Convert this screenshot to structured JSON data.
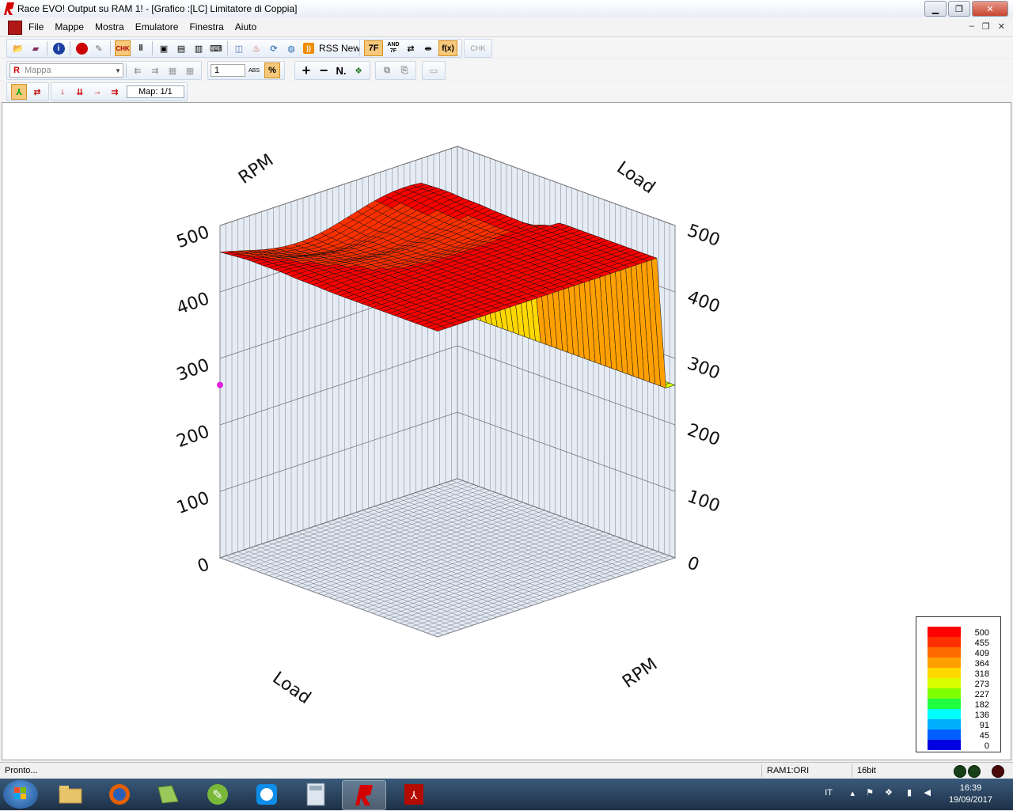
{
  "window": {
    "title": "Race EVO! Output su RAM 1! - [Grafico :[LC] Limitatore di Coppia]"
  },
  "menu": {
    "items": [
      "File",
      "Mappe",
      "Mostra",
      "Emulatore",
      "Finestra",
      "Aiuto"
    ]
  },
  "toolbar1": {
    "rss_label": "RSS News",
    "btn_7f": "7F",
    "btn_and": "AND 7F",
    "btn_fx": "f(x)",
    "btn_chk": "CHK"
  },
  "toolbar2": {
    "map_combo_prefix": "R",
    "map_combo_value": "Mappa",
    "step_value": "1",
    "abs_label": "ABS",
    "n_label": "N."
  },
  "toolbar3": {
    "map_counter": "Map: 1/1"
  },
  "chart_data": {
    "type": "surface3d",
    "axes": {
      "x_label": "Load",
      "y_label": "RPM",
      "z_ticks": [
        "0",
        "100",
        "200",
        "300",
        "400",
        "500"
      ],
      "z_range": [
        0,
        500
      ]
    },
    "legend": {
      "values": [
        "500",
        "455",
        "409",
        "364",
        "318",
        "273",
        "227",
        "182",
        "136",
        "91",
        "45",
        "0"
      ],
      "colors": [
        "#ff0000",
        "#ff3000",
        "#ff6a00",
        "#ffa000",
        "#ffd800",
        "#d8ff00",
        "#80ff00",
        "#20ff40",
        "#00ffff",
        "#00b0ff",
        "#0060ff",
        "#0000e0"
      ]
    }
  },
  "status": {
    "left": "Pronto...",
    "ram": "RAM1:ORI",
    "bits": "16bit"
  },
  "taskbar": {
    "lang": "IT",
    "time": "16:39",
    "date": "19/09/2017"
  }
}
